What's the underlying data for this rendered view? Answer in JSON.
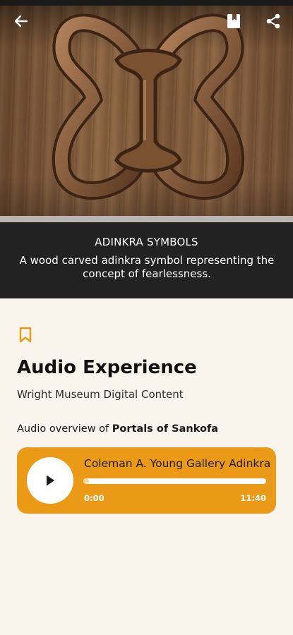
{
  "hero": {
    "caption_title": "ADINKRA SYMBOLS",
    "caption_description": "A wood carved adinkra symbol representing the concept of fearlessness."
  },
  "icons": {
    "back": "arrow-left-icon",
    "bookmark": "bookmark-icon",
    "share": "share-icon",
    "bookmark_outline": "bookmark-outline-icon",
    "play": "play-icon"
  },
  "content": {
    "title": "Audio Experience",
    "subtitle": "Wright Museum Digital Content",
    "overview_prefix": "Audio overview of ",
    "overview_name": "Portals of Sankofa"
  },
  "player": {
    "track_title": "Coleman A. Young Gallery Adinkra",
    "current_time": "0:00",
    "duration": "11:40",
    "progress": 0.0
  },
  "colors": {
    "accent": "#ea9a16",
    "caption_bg": "#222222",
    "page_bg": "#faf5ec"
  }
}
